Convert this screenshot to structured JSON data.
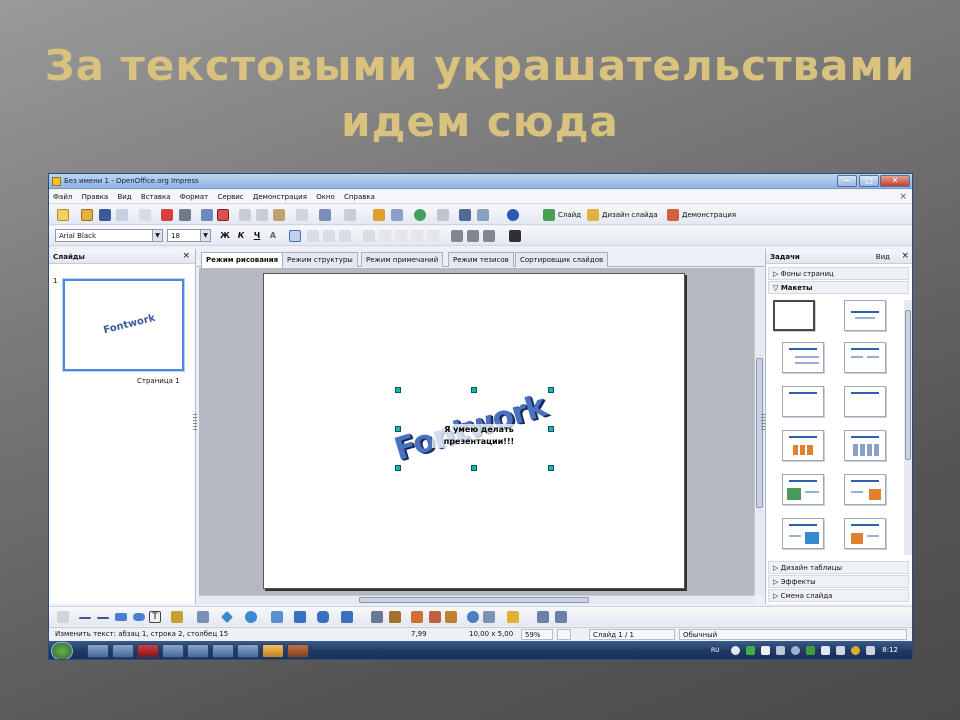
{
  "slide_title": "За текстовыми украшательствами идем сюда",
  "window": {
    "title": "Без имени 1 - OpenOffice.org Impress",
    "min": "−",
    "max": "□",
    "close": "✕"
  },
  "menu": [
    "Файл",
    "Правка",
    "Вид",
    "Вставка",
    "Формат",
    "Сервис",
    "Демонстрация",
    "Окно",
    "Справка"
  ],
  "menu_close": "×",
  "toolbar": {
    "slide": "Слайд",
    "slide_design": "Дизайн слайда",
    "demo": "Демонстрация"
  },
  "format": {
    "font": "Arial Black",
    "size": "18",
    "bold": "Ж",
    "italic": "К",
    "underline": "Ч",
    "shadow": "A"
  },
  "slides_panel": {
    "title": "Слайды",
    "close": "×",
    "slide_number": "1",
    "thumb_word": "Fontwork",
    "page_label": "Страница 1"
  },
  "view_tabs": [
    "Режим рисования",
    "Режим структуры",
    "Режим примечаний",
    "Режим тезисов",
    "Сортировщик слайдов"
  ],
  "canvas": {
    "fontwork_word": "Fontwork",
    "text_line1": "Я умею делать",
    "text_line2": "презентации!!!"
  },
  "tasks_panel": {
    "title": "Задачи",
    "view": "Вид",
    "close": "×",
    "master_pages": "Фоны страниц",
    "layouts": "Макеты",
    "table_design": "Дизайн таблицы",
    "effects": "Эффекты",
    "transition": "Смена слайда"
  },
  "status": {
    "edit_text": "Изменить текст: абзац 1, строка 2, столбец 15",
    "position": "7,99",
    "size": "10,00 x 5,00",
    "zoom": "59%",
    "slide": "Слайд 1 / 1",
    "style": "Обычный"
  },
  "taskbar": {
    "lang": "RU",
    "clock": "8:12"
  },
  "colors": {
    "title": "#d9c27e",
    "accent": "#4a8ad8",
    "handle": "#19b3b3"
  }
}
